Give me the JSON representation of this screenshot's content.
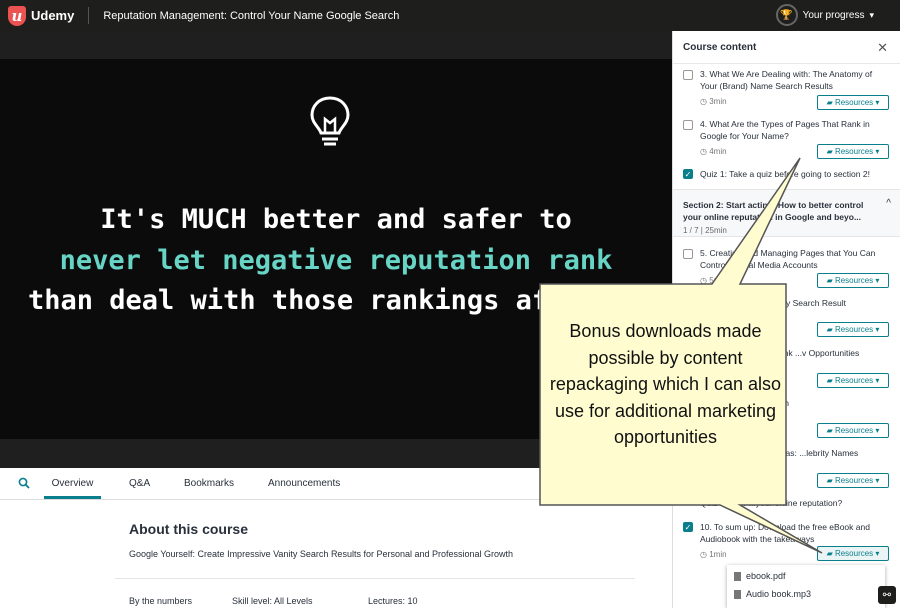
{
  "topbar": {
    "brand": "Udemy",
    "logo_letter": "u",
    "course_title": "Reputation Management: Control Your Name Google Search",
    "progress_label": "Your progress",
    "progress_icon": "trophy-icon"
  },
  "slide": {
    "line1": "It's MUCH better and safer to",
    "line2": "never let negative reputation rank",
    "line3": "than deal with those rankings after",
    "icon": "lightbulb-icon"
  },
  "tabs": [
    {
      "label": "Overview",
      "active": true
    },
    {
      "label": "Q&A"
    },
    {
      "label": "Bookmarks"
    },
    {
      "label": "Announcements"
    }
  ],
  "about": {
    "title": "About this course",
    "description": "Google Yourself: Create Impressive Vanity Search Results for Personal and Professional Growth",
    "stats": [
      "By the numbers",
      "Skill level: All Levels",
      "Lectures: 10"
    ]
  },
  "sidebar": {
    "header": "Course content",
    "items": [
      {
        "title": "3. What We Are Dealing with: The Anatomy of Your (Brand) Name Search Results",
        "duration": "3min",
        "resources": "Resources"
      },
      {
        "title": "4. What Are the Types of Pages That Rank in Google for Your Name?",
        "duration": "4min",
        "resources": "Resources"
      },
      {
        "title": "Quiz 1: Take a quiz before going to section 2!",
        "checked": true
      },
      {
        "title": "5. Creating and Managing Pages that You Can Control: Social Media Accounts",
        "duration": "5min",
        "resources": "Resources"
      },
      {
        "title": "6. ...Blog Interviews: ...y Search Result",
        "resources": "Resources"
      },
      {
        "title": "7. ...t Page to Help Rank ...v Opportunities",
        "resources": "Resources"
      },
      {
        "title": "8. ...Your Image Search",
        "resources": "Resources"
      },
      {
        "title": "9. ...nagement Dilemmas: ...lebrity Names",
        "resources": "Resources"
      },
      {
        "title": "Quiz 2: How ...your online reputation?"
      },
      {
        "title": "10. To sum up: Download the free eBook and Audiobook with the takeaways",
        "duration": "1min",
        "resources": "Resources",
        "checked": true
      }
    ],
    "section": {
      "title": "Section 2: Start acting: How to better control your online reputation in Google and beyo...",
      "meta": "1 / 7 | 25min"
    }
  },
  "dropdown": {
    "items": [
      "ebook.pdf",
      "Audio book.mp3"
    ]
  },
  "callout": {
    "text": "Bonus downloads made possible by content repackaging which I can also use for additional marketing opportunities",
    "fill": "#fffdd0",
    "border": "#555555"
  },
  "colors": {
    "accent": "#0a7f8c",
    "brand": "#ec5252",
    "highlight_text": "#67d4c6"
  }
}
